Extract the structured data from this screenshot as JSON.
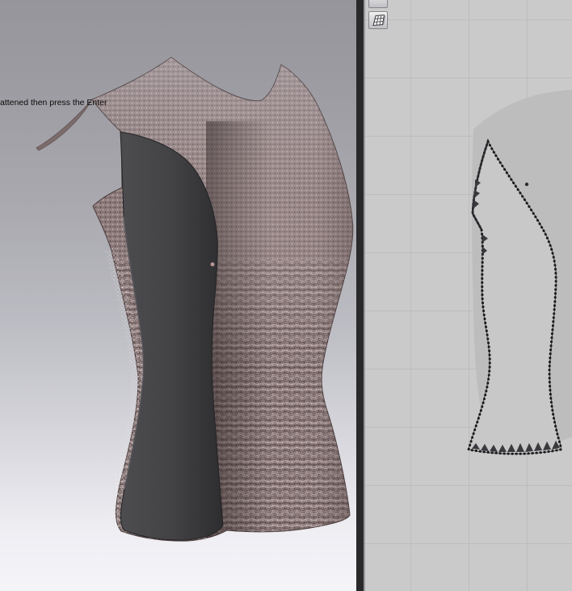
{
  "viewport_3d": {
    "hint_text": "attened then press the Enter",
    "background_top": "#95959b",
    "background_bottom": "#f4f4f9",
    "garment": {
      "fabric_color": "#8e7c7c",
      "fabric_highlight": "#bcaaaa",
      "fabric_shadow": "#564949",
      "side_panel_color": "#424244",
      "side_panel_edge": "#232325"
    }
  },
  "divider": {
    "color": "#29292b"
  },
  "viewport_2d": {
    "background": "#cacaca",
    "grid_color": "#bdbdbd",
    "silhouette_color": "#bdbdbd",
    "mesh_piece": {
      "fill": "#c8c8c8",
      "wire_color": "#76767b",
      "outline_color": "#2e2e32",
      "vertex_dot_color": "#1d1d1f"
    },
    "toolbar": [
      {
        "id": "object-button",
        "icon": "3d-object-icon"
      },
      {
        "id": "mesh-button",
        "icon": "mesh-grid-icon"
      }
    ]
  }
}
